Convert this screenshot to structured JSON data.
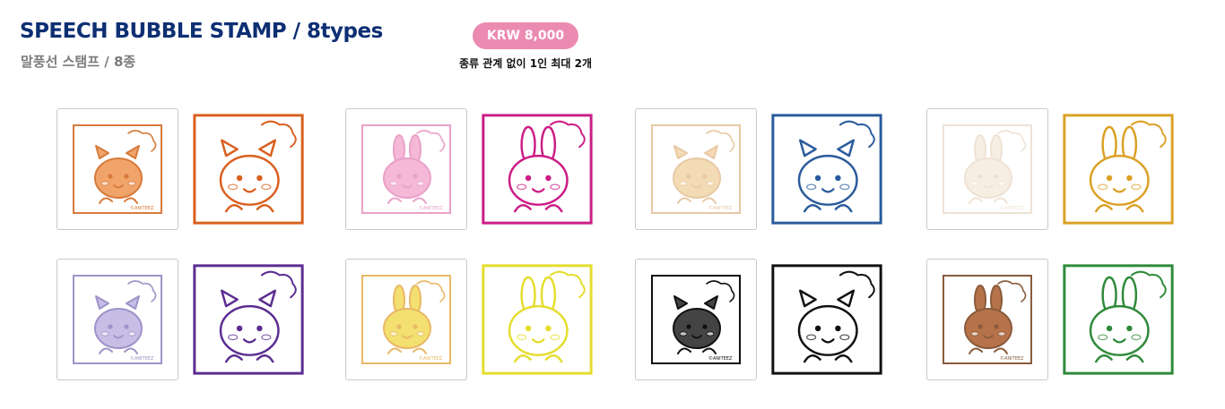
{
  "header": {
    "title": "SPEECH BUBBLE STAMP / 8types",
    "subtitle": "말풍선 스탬프 / 8종",
    "price": "KRW 8,000",
    "purchase_limit": "종류 관계 없이 1인 최대 2개"
  },
  "stamps": [
    {
      "id": "squirrel",
      "color": "#d9601f",
      "art_color": "#d77a3a",
      "fill": "#f0a46a",
      "label": "©ANITEEZ",
      "art": "character-art"
    },
    {
      "id": "rabbit",
      "color": "#cc1d86",
      "art_color": "#e9a1c8",
      "fill": "#f5b9d7",
      "label": "©ANITEEZ",
      "art": "character-art"
    },
    {
      "id": "puppy",
      "color": "#2a5b9b",
      "art_color": "#e8c9a5",
      "fill": "#f3dcb5",
      "label": "©ANITEEZ",
      "art": "character-art"
    },
    {
      "id": "fox",
      "color": "#dba125",
      "art_color": "#efe2d5",
      "fill": "#f7eee3",
      "label": "©ANITEEZ",
      "art": "character-art"
    },
    {
      "id": "cat",
      "color": "#5b2d91",
      "art_color": "#9d93c8",
      "fill": "#c8bde5",
      "label": "©ANITEEZ",
      "art": "character-art"
    },
    {
      "id": "chick",
      "color": "#e5dd2e",
      "art_color": "#e9b866",
      "fill": "#f3e070",
      "label": "©ANITEEZ",
      "art": "character-art"
    },
    {
      "id": "black-cat",
      "color": "#111111",
      "art_color": "#111111",
      "fill": "#444444",
      "label": "©ANITEEZ",
      "art": "character-art"
    },
    {
      "id": "bear",
      "color": "#2f8a3a",
      "art_color": "#8a5b3c",
      "fill": "#b6734a",
      "label": "©ANITEEZ",
      "art": "character-art"
    }
  ]
}
